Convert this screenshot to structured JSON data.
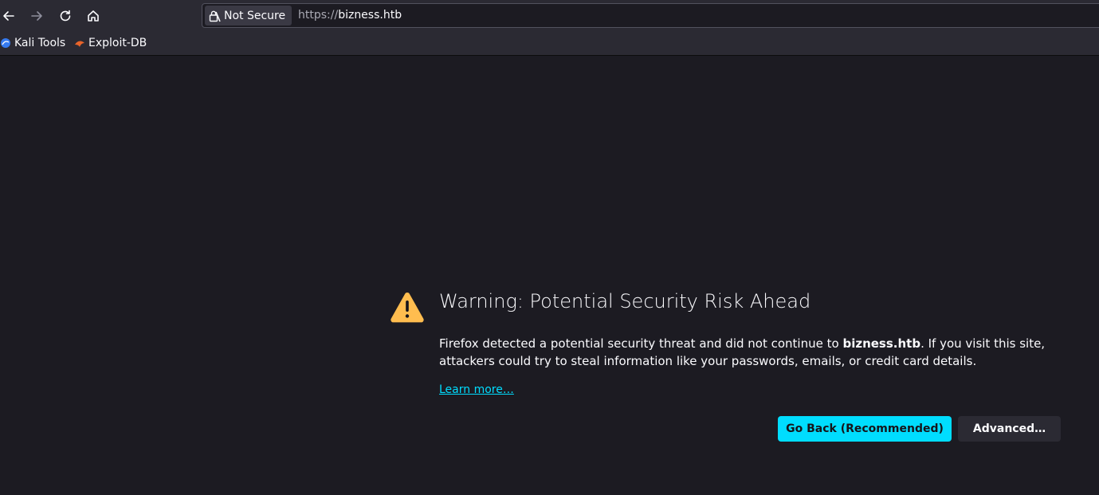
{
  "toolbar": {
    "back_icon": "arrow-left-icon",
    "forward_icon": "arrow-right-icon",
    "reload_icon": "reload-icon",
    "home_icon": "home-icon"
  },
  "urlbar": {
    "security_label": "Not Secure",
    "url_scheme": "https://",
    "url_host": "bizness.htb"
  },
  "bookmarks": [
    {
      "label": "Kali Tools",
      "icon": "kali-icon"
    },
    {
      "label": "Exploit-DB",
      "icon": "exploit-db-icon"
    }
  ],
  "error_page": {
    "title": "Warning: Potential Security Risk Ahead",
    "desc_before": "Firefox detected a potential security threat and did not continue to ",
    "desc_host": "bizness.htb",
    "desc_after": ". If you visit this site, attackers could try to steal information like your passwords, emails, or credit card details.",
    "learn_more": "Learn more…",
    "go_back_label": "Go Back (Recommended)",
    "advanced_label": "Advanced…"
  },
  "colors": {
    "accent": "#00ddff",
    "warning": "#ffbd4f",
    "background": "#1c1b22"
  }
}
